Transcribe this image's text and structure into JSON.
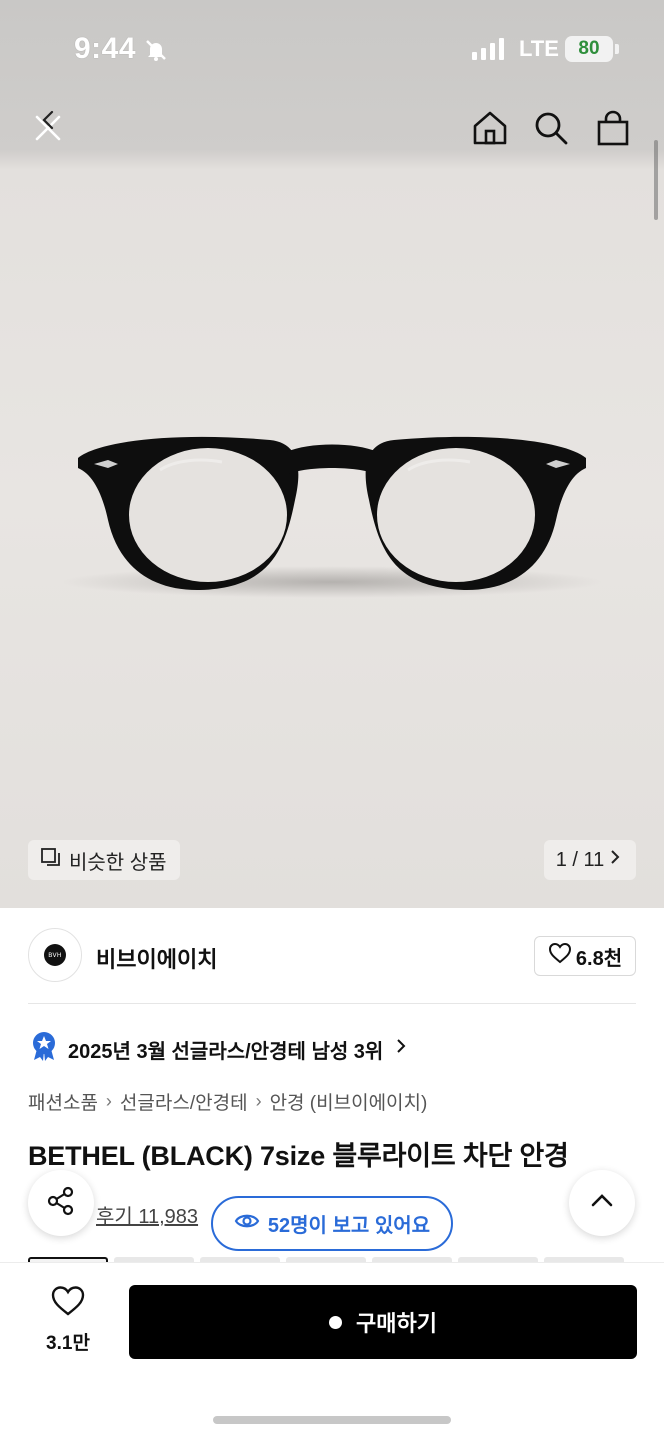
{
  "status_bar": {
    "time": "9:44",
    "network": "LTE",
    "battery": "80",
    "bell_icon": "bell-slash-icon",
    "signal_icon": "cellular-signal-icon"
  },
  "nav": {
    "back_icon": "back-close-icon",
    "home_icon": "home-icon",
    "search_icon": "search-icon",
    "cart_icon": "shopping-bag-icon"
  },
  "hero": {
    "similar_label": "비슷한 상품",
    "counter": "1 / 11",
    "image_subject": "black-glasses"
  },
  "brand": {
    "name": "비브이에이치",
    "likes": "6.8천"
  },
  "product": {
    "rank_text": "2025년 3월 선글라스/안경테 남성 3위",
    "breadcrumbs": [
      "패션소품",
      "선글라스/안경테",
      "안경 (비브이에이치)"
    ],
    "title": "BETHEL (BLACK) 7size 블루라이트 차단 안경",
    "reviews": "후기 11,983",
    "viewers": "52명이 보고 있어요"
  },
  "bottom": {
    "wish_count": "3.1만",
    "buy_label": "구매하기"
  },
  "colors": {
    "accent_blue": "#2a6bd8",
    "buy_button": "#000000",
    "battery_green": "#2f8f3c"
  }
}
